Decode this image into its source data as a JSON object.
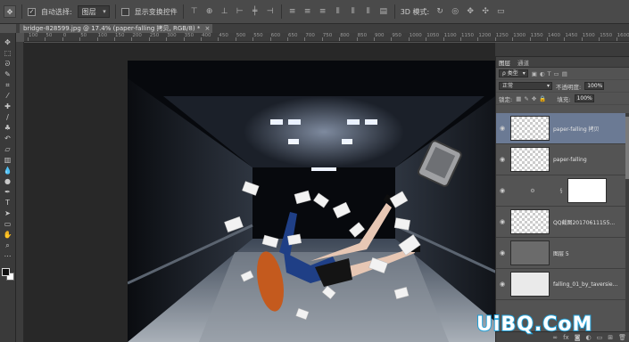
{
  "options_bar": {
    "auto_select_label": "自动选择:",
    "auto_select_value": "图层",
    "show_transform_label": "显示变换控件",
    "mode_3d_label": "3D 模式:"
  },
  "document": {
    "tab_title": "bridge-828599.jpg @ 17.4% (paper-falling 拷贝, RGB/8) *",
    "close_glyph": "×"
  },
  "ruler": {
    "ticks": [
      "100",
      "50",
      "0",
      "50",
      "100",
      "150",
      "200",
      "250",
      "300",
      "350",
      "400",
      "450",
      "500",
      "550",
      "600",
      "650",
      "700",
      "750",
      "800",
      "850",
      "900",
      "950",
      "1000",
      "1050",
      "1100",
      "1150",
      "1200",
      "1250",
      "1300",
      "1350",
      "1400",
      "1450",
      "1500",
      "1550",
      "1600"
    ]
  },
  "layers_panel": {
    "tabs": [
      "图层",
      "通道"
    ],
    "kind_filter": "ρ 类型",
    "blend_mode": "正常",
    "opacity_label": "不透明度:",
    "opacity_value": "100%",
    "lock_label": "锁定:",
    "fill_label": "填充:",
    "fill_value": "100%",
    "layers": [
      {
        "name": "paper-falling 拷贝",
        "selected": true,
        "thumb": "checker"
      },
      {
        "name": "paper-falling",
        "selected": false,
        "thumb": "checker"
      },
      {
        "name": "",
        "selected": false,
        "thumb": "mask",
        "adjustment": true
      },
      {
        "name": "QQ截图20170611155...",
        "selected": false,
        "thumb": "checker"
      },
      {
        "name": "图层 5",
        "selected": false,
        "thumb": "dark"
      },
      {
        "name": "falling_01_by_taversie...",
        "selected": false,
        "thumb": "solid"
      }
    ],
    "footer_icons": [
      "link-icon",
      "fx-icon",
      "mask-icon",
      "adjust-icon",
      "folder-icon",
      "new-layer-icon",
      "trash-icon"
    ]
  },
  "watermark": "UiBQ.CoM",
  "colors": {
    "ui_bg": "#535353",
    "panel_selected": "#6b7a94",
    "watermark_stroke": "#1d9fd8"
  }
}
